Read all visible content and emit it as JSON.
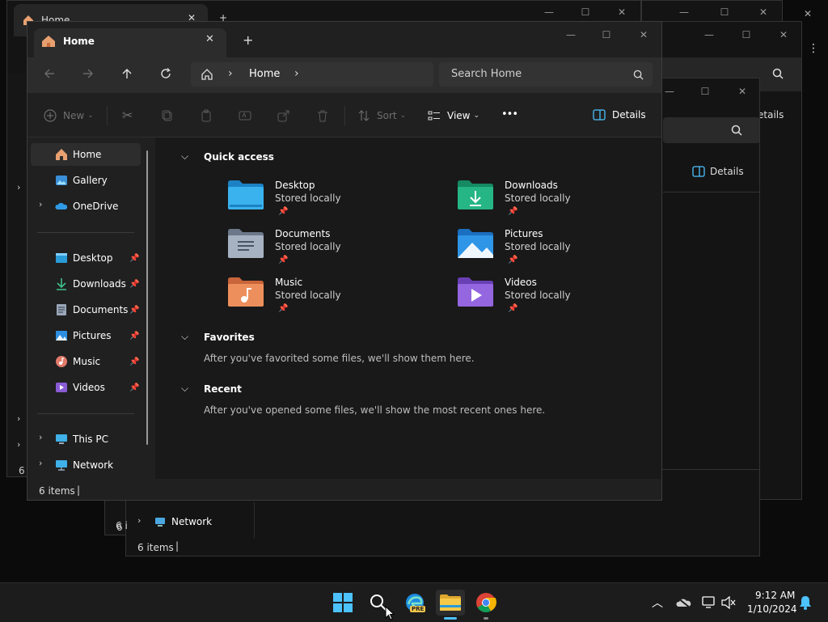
{
  "background_windows": {
    "win1": {
      "tab_title": "Home"
    },
    "win3": {
      "details_label": "Details",
      "status": "6 items",
      "sidebar_network": "Network"
    },
    "other_details": "etails",
    "other_status_a": "6 i",
    "other_status_b": "6 i",
    "other_status_c": "6 i"
  },
  "window": {
    "tab_title": "Home",
    "new_tab_symbol": "+",
    "nav": {
      "breadcrumb": "Home",
      "search_placeholder": "Search Home"
    },
    "commands": {
      "new": "New",
      "sort": "Sort",
      "view": "View",
      "more": "•••",
      "details": "Details"
    },
    "sidebar": {
      "top": [
        {
          "label": "Home"
        },
        {
          "label": "Gallery"
        },
        {
          "label": "OneDrive"
        }
      ],
      "pinned": [
        {
          "label": "Desktop"
        },
        {
          "label": "Downloads"
        },
        {
          "label": "Documents"
        },
        {
          "label": "Pictures"
        },
        {
          "label": "Music"
        },
        {
          "label": "Videos"
        }
      ],
      "bottom": [
        {
          "label": "This PC"
        },
        {
          "label": "Network"
        }
      ]
    },
    "content": {
      "quick_access_title": "Quick access",
      "items": [
        {
          "name": "Desktop",
          "sub": "Stored locally"
        },
        {
          "name": "Downloads",
          "sub": "Stored locally"
        },
        {
          "name": "Documents",
          "sub": "Stored locally"
        },
        {
          "name": "Pictures",
          "sub": "Stored locally"
        },
        {
          "name": "Music",
          "sub": "Stored locally"
        },
        {
          "name": "Videos",
          "sub": "Stored locally"
        }
      ],
      "favorites_title": "Favorites",
      "favorites_text": "After you've favorited some files, we'll show them here.",
      "recent_title": "Recent",
      "recent_text": "After you've opened some files, we'll show the most recent ones here."
    },
    "status": "6 items"
  },
  "taskbar": {
    "time": "9:12 AM",
    "date": "1/10/2024",
    "edge_badge": "PRE"
  },
  "colors": {
    "accent": "#4cc2ff",
    "folder_blue": "#2a9bd8",
    "folder_green": "#1fa67a",
    "folder_grey": "#8e9aab",
    "folder_orange": "#e58a4e",
    "folder_purple": "#8a5bd6"
  }
}
